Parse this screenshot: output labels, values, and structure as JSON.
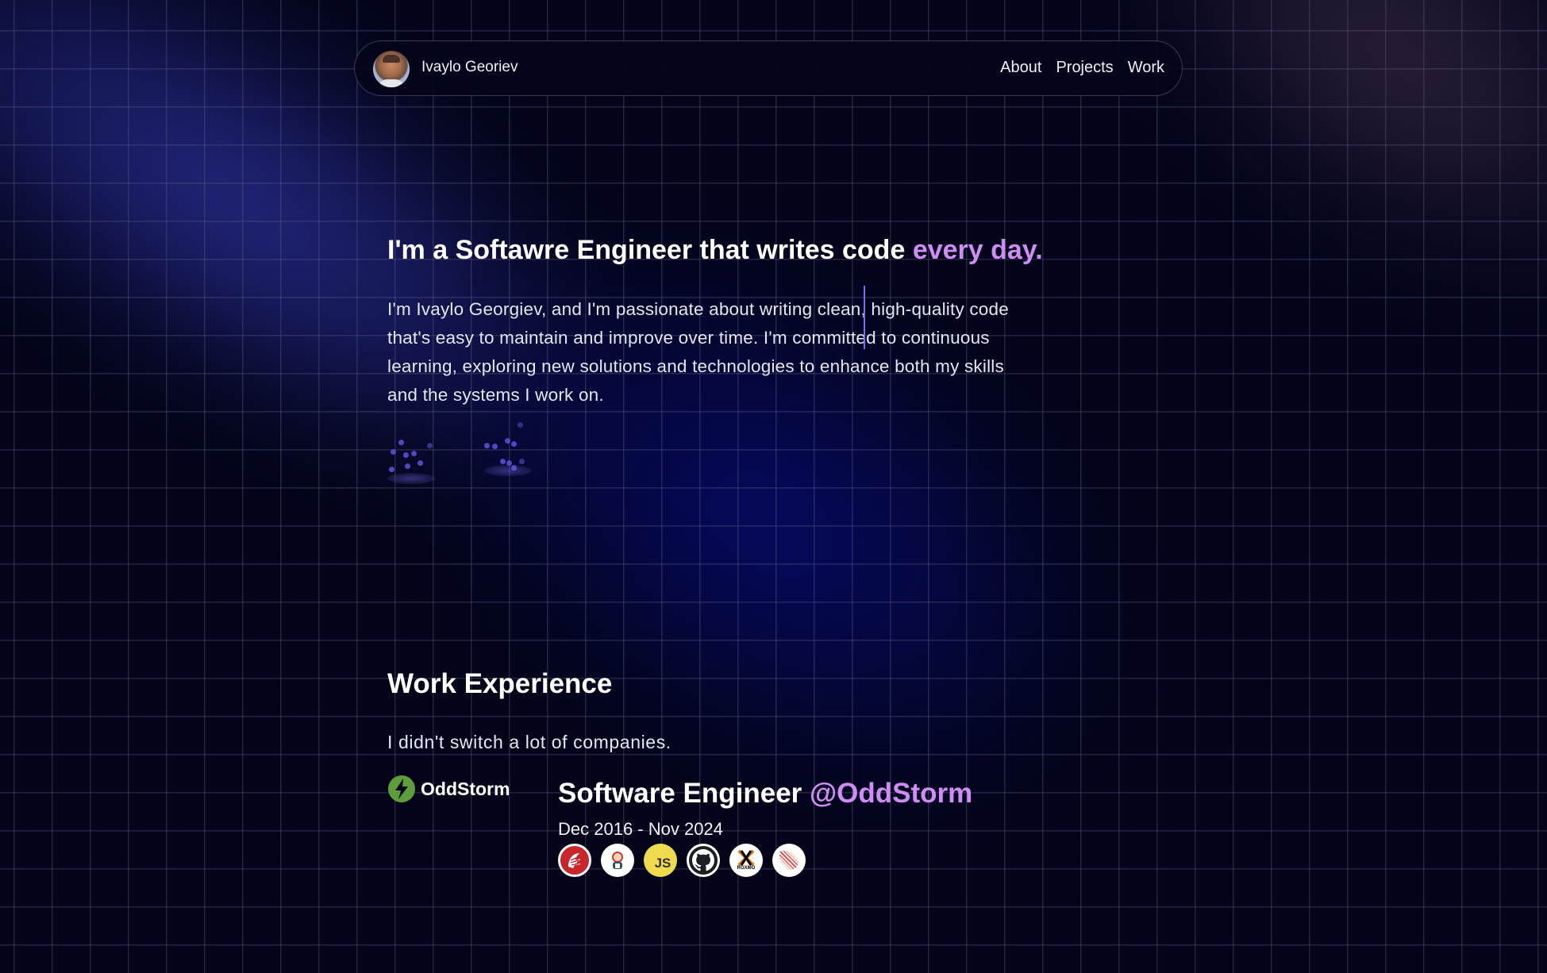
{
  "nav": {
    "brand_name": "Ivaylo Georiev",
    "avatar_alt": "profile photo",
    "links": [
      {
        "label": "About"
      },
      {
        "label": "Projects"
      },
      {
        "label": "Work"
      }
    ]
  },
  "hero": {
    "title_main": "I'm a Softawre Engineer that writes code ",
    "title_accent": "every day.",
    "paragraph": "I'm Ivaylo Georgiev, and I'm passionate about writing clean, high-quality code that's easy to maintain and improve over time. I'm committed to continuous learning, exploring new solutions and technologies to enhance both my skills and the systems I work on."
  },
  "work": {
    "title": "Work Experience",
    "subtitle": "I didn't switch a lot of companies.",
    "jobs": [
      {
        "company": "OddStorm",
        "role": "Software Engineer ",
        "company_handle": "@OddStorm",
        "dates": "Dec 2016 - Nov 2024",
        "technologies": [
          {
            "name": "Delphi",
            "icon": "delphi-icon"
          },
          {
            "name": "Jenkins",
            "icon": "jenkins-icon"
          },
          {
            "name": "JavaScript",
            "icon": "javascript-icon",
            "label": "JS"
          },
          {
            "name": "GitHub",
            "icon": "github-icon"
          },
          {
            "name": "Proxmox",
            "icon": "proxmox-icon",
            "label": "ROXMO"
          },
          {
            "name": "Meteor",
            "icon": "meteor-icon"
          }
        ]
      }
    ]
  },
  "colors": {
    "background": "#03041a",
    "accent": "#d08cf5",
    "company_green": "#5b9e3a",
    "cursor": "#7a6bf0"
  }
}
